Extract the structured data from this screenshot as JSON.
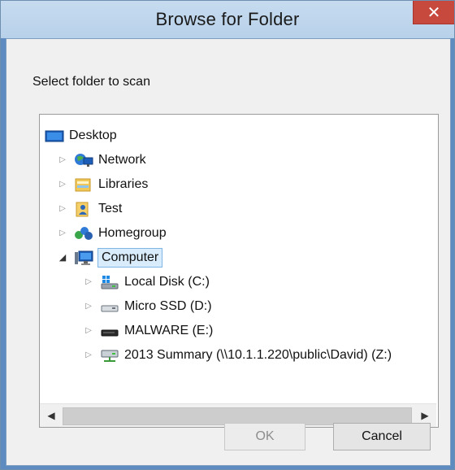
{
  "window": {
    "title": "Browse for Folder",
    "close_glyph": "✕"
  },
  "dialog": {
    "prompt": "Select folder to scan"
  },
  "tree": {
    "items": [
      {
        "label": "Desktop",
        "icon": "desktop-icon",
        "expander": ""
      },
      {
        "label": "Network",
        "icon": "network-icon",
        "expander": "▷"
      },
      {
        "label": "Libraries",
        "icon": "libraries-icon",
        "expander": "▷"
      },
      {
        "label": "Test",
        "icon": "user-folder-icon",
        "expander": "▷"
      },
      {
        "label": "Homegroup",
        "icon": "homegroup-icon",
        "expander": "▷"
      },
      {
        "label": "Computer",
        "icon": "computer-icon",
        "expander": "◢",
        "selected": true
      },
      {
        "label": "Local Disk (C:)",
        "icon": "system-drive-icon",
        "expander": "▷"
      },
      {
        "label": "Micro SSD (D:)",
        "icon": "drive-icon",
        "expander": "▷"
      },
      {
        "label": "MALWARE (E:)",
        "icon": "removable-drive-icon",
        "expander": "▷"
      },
      {
        "label": "2013 Summary (\\\\10.1.1.220\\public\\David) (Z:)",
        "icon": "network-drive-icon",
        "expander": "▷"
      }
    ]
  },
  "scrollbar": {
    "left_arrow": "◀",
    "right_arrow": "▶"
  },
  "buttons": {
    "ok": "OK",
    "cancel": "Cancel"
  },
  "colors": {
    "title_bar": "#b8d1ea",
    "close": "#c7483d",
    "selection": "#d9ecfb",
    "selection_border": "#7fb6e6"
  }
}
